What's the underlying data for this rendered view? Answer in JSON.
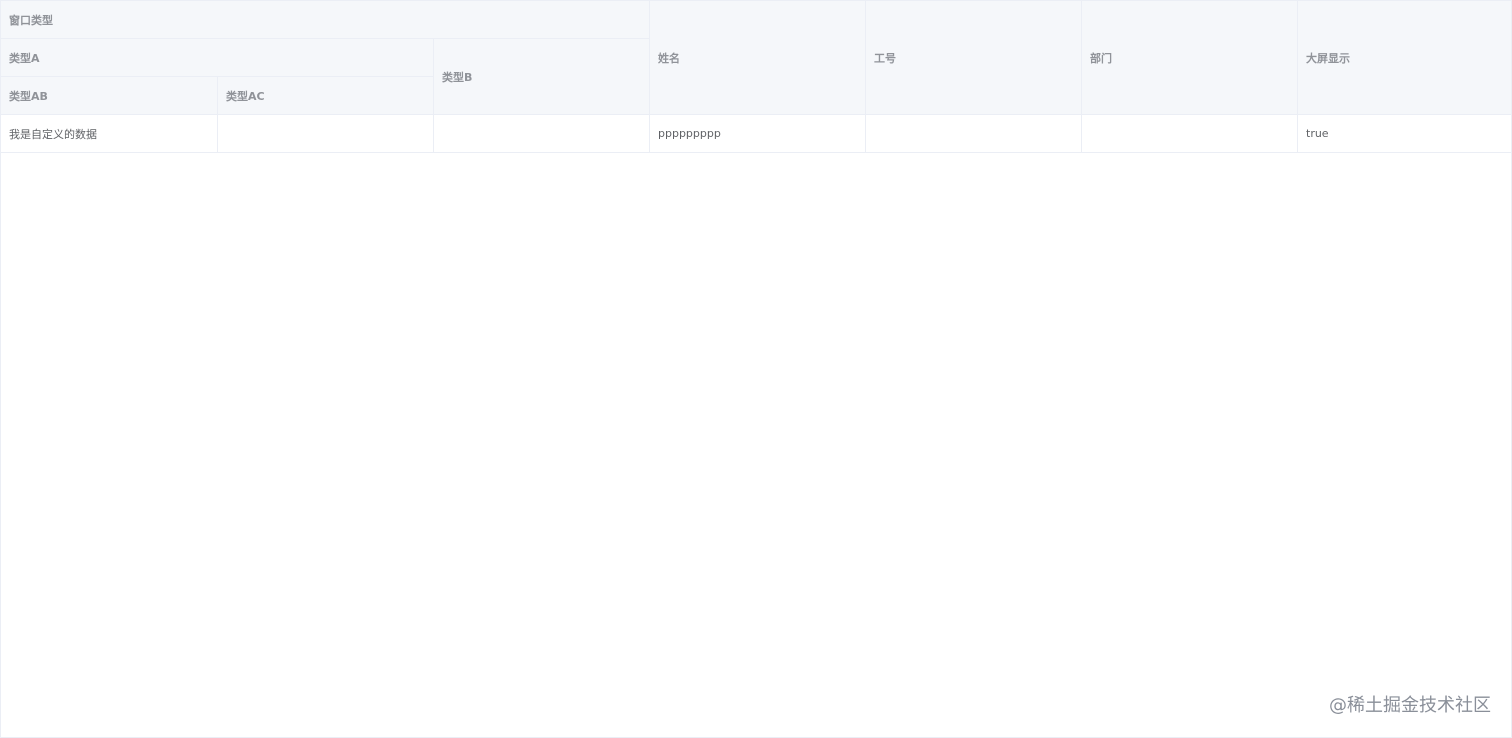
{
  "table": {
    "header": {
      "window_type": "窗口类型",
      "type_a": "类型A",
      "type_ab": "类型AB",
      "type_ac": "类型AC",
      "type_b": "类型B",
      "name": "姓名",
      "employee_id": "工号",
      "department": "部门",
      "big_screen": "大屏显示"
    },
    "rows": [
      {
        "type_ab": "我是自定义的数据",
        "type_ac": "",
        "type_b": "",
        "name": "ppppppppp",
        "employee_id": "",
        "department": "",
        "big_screen": "true"
      }
    ]
  },
  "watermark": {
    "text": "@稀土掘金技术社区"
  }
}
